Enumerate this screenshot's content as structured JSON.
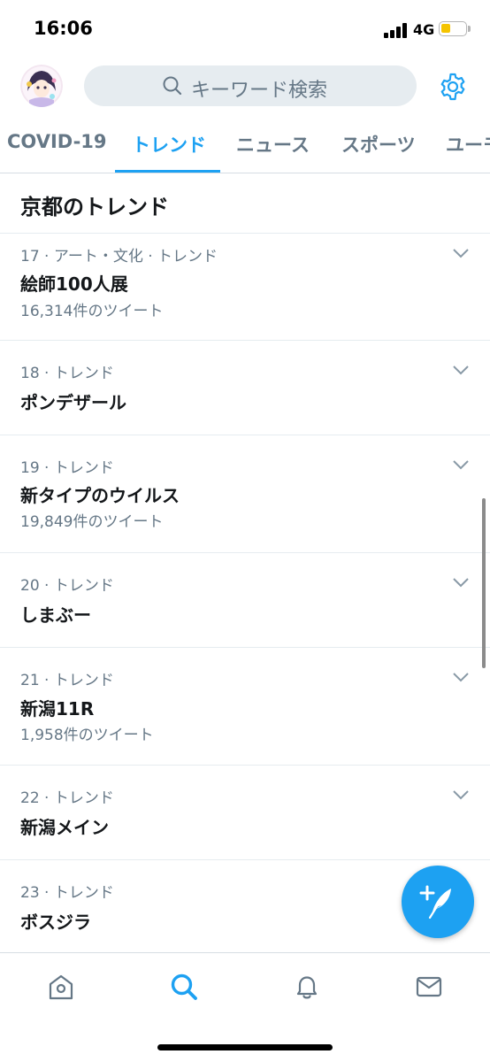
{
  "status": {
    "time": "16:06",
    "network": "4G"
  },
  "header": {
    "search_placeholder": "キーワード検索"
  },
  "tabs": [
    {
      "label": "COVID-19"
    },
    {
      "label": "トレンド"
    },
    {
      "label": "ニュース"
    },
    {
      "label": "スポーツ"
    },
    {
      "label": "ユーモ"
    }
  ],
  "section": {
    "title": "京都のトレンド"
  },
  "trends": [
    {
      "meta": "17 · アート・文化 · トレンド",
      "name": "絵師100人展",
      "count": "16,314件のツイート"
    },
    {
      "meta": "18 · トレンド",
      "name": "ポンデザール",
      "count": ""
    },
    {
      "meta": "19 · トレンド",
      "name": "新タイプのウイルス",
      "count": "19,849件のツイート"
    },
    {
      "meta": "20 · トレンド",
      "name": "しまぶー",
      "count": ""
    },
    {
      "meta": "21 · トレンド",
      "name": "新潟11R",
      "count": "1,958件のツイート"
    },
    {
      "meta": "22 · トレンド",
      "name": "新潟メイン",
      "count": ""
    },
    {
      "meta": "23 · トレンド",
      "name": "ボスジラ",
      "count": ""
    }
  ],
  "icons": {
    "search": "search-icon",
    "settings": "gear-icon",
    "chevron": "chevron-down-icon",
    "compose": "compose-tweet-icon",
    "home": "home-icon",
    "explore": "search-icon",
    "notifications": "bell-icon",
    "messages": "mail-icon"
  },
  "colors": {
    "accent": "#1da1f2",
    "secondary_text": "#657786",
    "primary_text": "#14171a",
    "battery": "#f5c400"
  }
}
